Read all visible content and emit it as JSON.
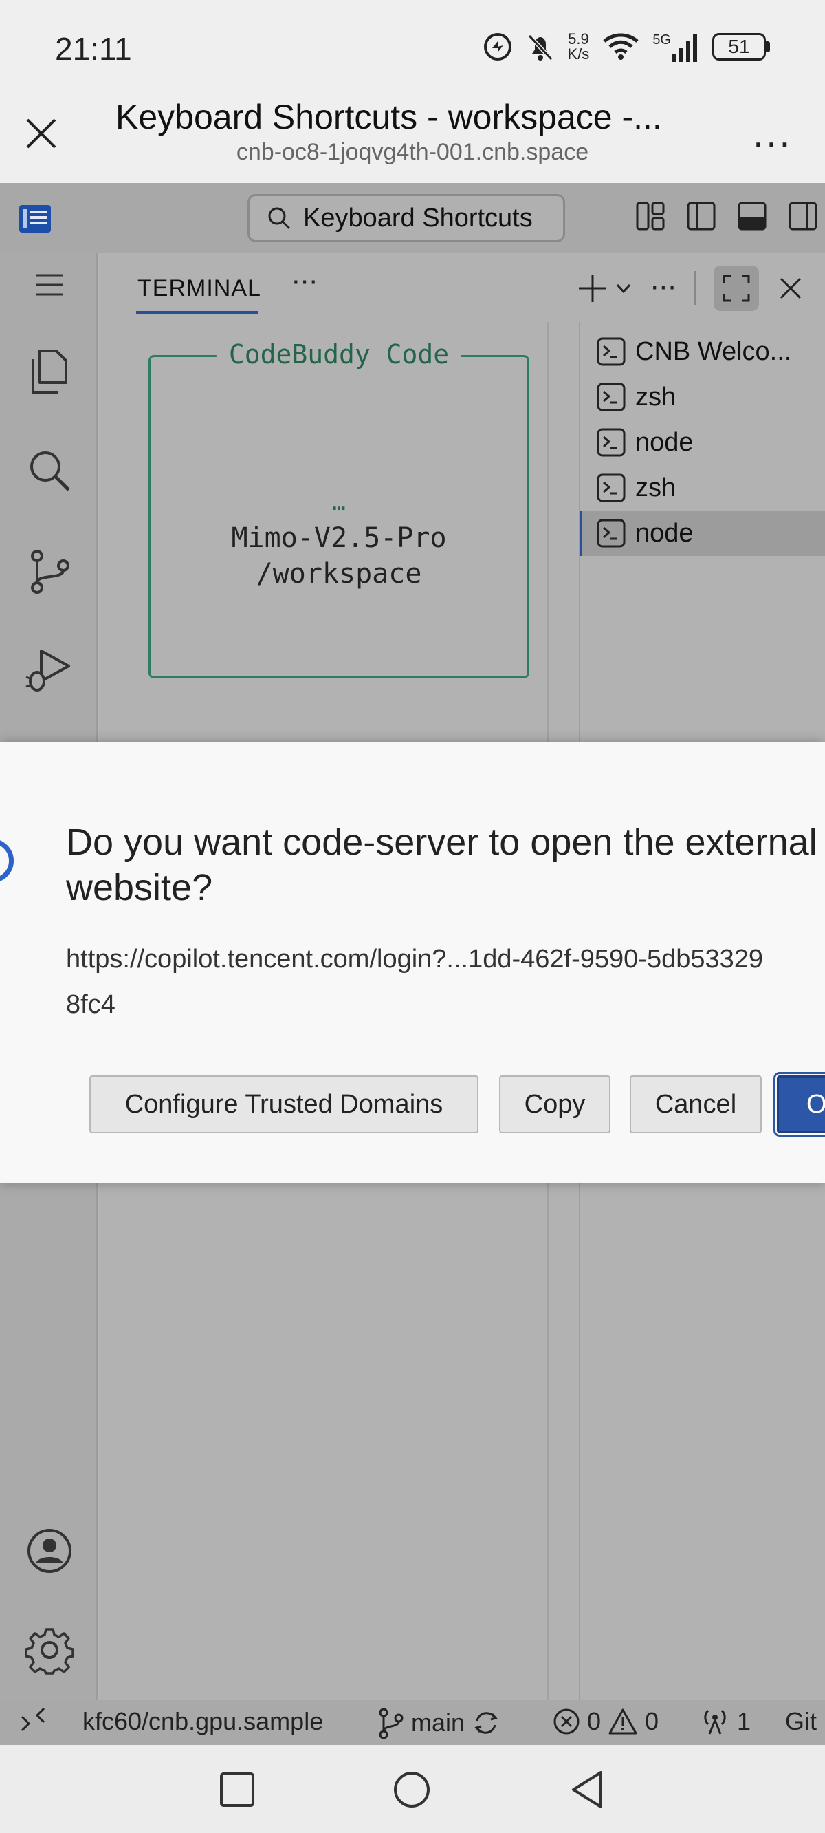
{
  "status_bar": {
    "time": "21:11",
    "net_speed_value": "5.9",
    "net_speed_unit": "K/s",
    "network_type": "5G",
    "battery": "51"
  },
  "browser": {
    "title": "Keyboard Shortcuts - workspace -...",
    "url": "cnb-oc8-1joqvg4th-001.cnb.space",
    "more_label": "..."
  },
  "vscode": {
    "command_center": "Keyboard Shortcuts",
    "panel": {
      "tab_label": "TERMINAL",
      "more_label": "···",
      "more_actions_label": "···"
    },
    "terminal": {
      "box_title": "CodeBuddy Code",
      "ellipsis": "…",
      "model": "Mimo-V2.5-Pro",
      "path": "/workspace"
    },
    "terminal_list": [
      {
        "label": "CNB Welco..."
      },
      {
        "label": "zsh"
      },
      {
        "label": "node"
      },
      {
        "label": "zsh"
      },
      {
        "label": "node",
        "active": true
      }
    ],
    "statusbar": {
      "repo": "kfc60/cnb.gpu.sample",
      "branch": "main",
      "errors": "0",
      "warnings": "0",
      "ports": "1",
      "extra": "Git"
    }
  },
  "dialog": {
    "title": "Do you want code-server to open the external website?",
    "detail": "https://copilot.tencent.com/login?...1dd-462f-9590-5db533298fc4",
    "buttons": {
      "configure": "Configure Trusted Domains",
      "copy": "Copy",
      "cancel": "Cancel",
      "open": "Open"
    }
  },
  "colors": {
    "accent": "#2c57a8",
    "terminal_green": "#2e7d5e",
    "dim_overlay": "#b2b2b2"
  }
}
